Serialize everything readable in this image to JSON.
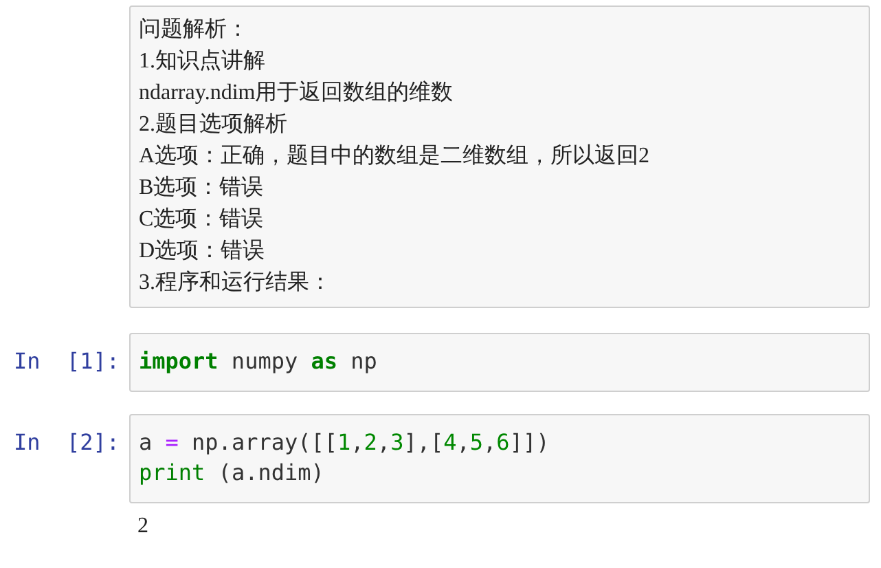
{
  "cells": [
    {
      "kind": "markdown",
      "lines": [
        "问题解析：",
        "1.知识点讲解",
        "ndarray.ndim用于返回数组的维数",
        "2.题目选项解析",
        "A选项：正确，题目中的数组是二维数组，所以返回2",
        "B选项：错误",
        "C选项：错误",
        "D选项：错误",
        "3.程序和运行结果："
      ]
    },
    {
      "kind": "code",
      "prompt": "In  [1]:",
      "lines": [
        [
          {
            "text": "import",
            "kind": "keyword"
          },
          {
            "text": " numpy ",
            "kind": "plain"
          },
          {
            "text": "as",
            "kind": "keyword"
          },
          {
            "text": " np",
            "kind": "plain"
          }
        ]
      ]
    },
    {
      "kind": "code",
      "prompt": "In  [2]:",
      "lines": [
        [
          {
            "text": "a ",
            "kind": "plain"
          },
          {
            "text": "=",
            "kind": "operator"
          },
          {
            "text": " np.array([[",
            "kind": "plain"
          },
          {
            "text": "1",
            "kind": "number"
          },
          {
            "text": ",",
            "kind": "plain"
          },
          {
            "text": "2",
            "kind": "number"
          },
          {
            "text": ",",
            "kind": "plain"
          },
          {
            "text": "3",
            "kind": "number"
          },
          {
            "text": "],[",
            "kind": "plain"
          },
          {
            "text": "4",
            "kind": "number"
          },
          {
            "text": ",",
            "kind": "plain"
          },
          {
            "text": "5",
            "kind": "number"
          },
          {
            "text": ",",
            "kind": "plain"
          },
          {
            "text": "6",
            "kind": "number"
          },
          {
            "text": "]])",
            "kind": "plain"
          }
        ],
        [
          {
            "text": "print",
            "kind": "builtin"
          },
          {
            "text": " (a.ndim)",
            "kind": "plain"
          }
        ]
      ],
      "output": "2"
    }
  ]
}
